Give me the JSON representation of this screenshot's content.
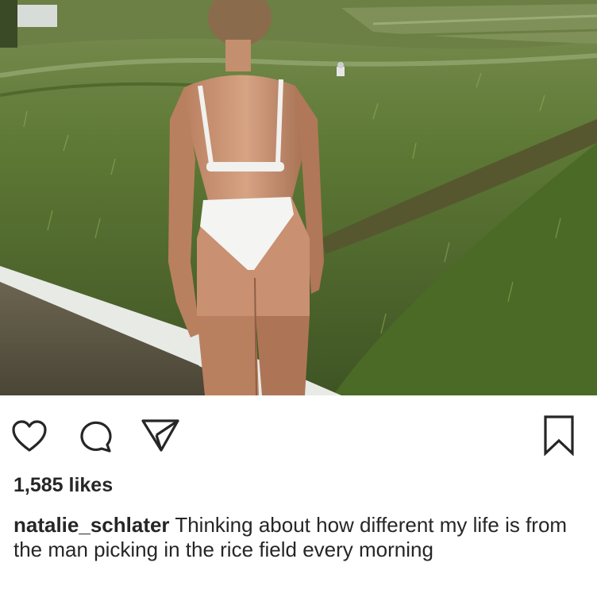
{
  "post": {
    "image_alt": "Woman in a white bikini standing at the edge of a green rice field",
    "actions": {
      "like_icon": "heart-outline-icon",
      "comment_icon": "speech-bubble-icon",
      "share_icon": "paper-plane-icon",
      "save_icon": "bookmark-outline-icon"
    },
    "likes_text": "1,585 likes",
    "caption": {
      "username": "natalie_schlater",
      "text": "Thinking about how different my life is from the man picking in the rice field every morning"
    }
  }
}
